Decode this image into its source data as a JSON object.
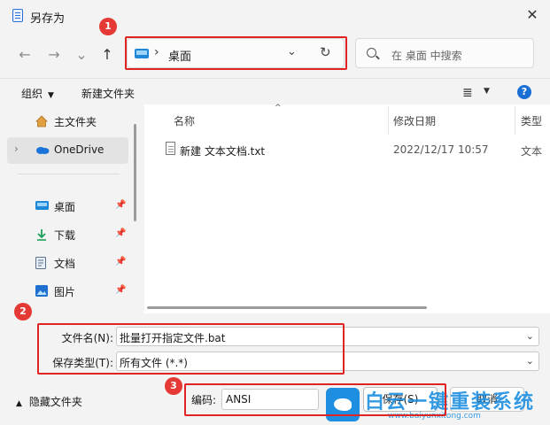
{
  "window": {
    "title": "另存为",
    "close_glyph": "✕"
  },
  "nav": {
    "back": "←",
    "forward": "→",
    "recent": "⌄",
    "up": "↑"
  },
  "address": {
    "chevron": "›",
    "location": "桌面",
    "drop": "⌄",
    "refresh": "↻"
  },
  "search": {
    "placeholder": "在 桌面 中搜索"
  },
  "toolbar": {
    "organize": "组织",
    "new_folder": "新建文件夹",
    "view_glyph": "≣",
    "help": "?"
  },
  "sidebar": {
    "items": [
      {
        "label": "主文件夹",
        "icon": "home-icon"
      },
      {
        "label": "OneDrive",
        "icon": "cloud-icon"
      },
      {
        "label": "桌面",
        "icon": "desktop-icon"
      },
      {
        "label": "下载",
        "icon": "download-icon"
      },
      {
        "label": "文档",
        "icon": "document-icon"
      },
      {
        "label": "图片",
        "icon": "image-icon"
      }
    ]
  },
  "columns": {
    "name": "名称",
    "modified": "修改日期",
    "type": "类型"
  },
  "files": [
    {
      "name": "新建 文本文档.txt",
      "modified": "2022/12/17 10:57",
      "type": "文本"
    }
  ],
  "form": {
    "filename_label": "文件名(N):",
    "filename_value": "批量打开指定文件.bat",
    "savetype_label": "保存类型(T):",
    "savetype_value": "所有文件  (*.*)",
    "encoding_label": "编码:",
    "encoding_value": "ANSI",
    "save_button": "保存(S)",
    "cancel_button": "取消",
    "hide_folders": "隐藏文件夹"
  },
  "annotations": {
    "badge1": "1",
    "badge2": "2",
    "badge3": "3",
    "color": "#e02424"
  },
  "watermark": {
    "title": "白云一键重装系统",
    "url": "www.baiyunxitong.com"
  }
}
